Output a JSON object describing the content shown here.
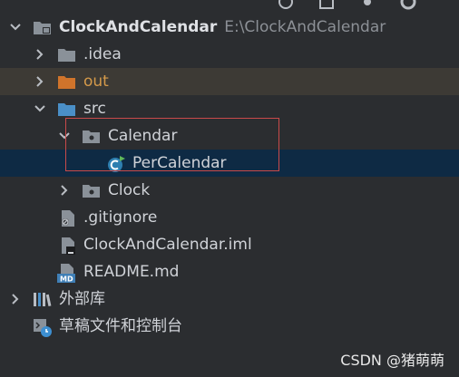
{
  "tree": {
    "root": {
      "label": "ClockAndCalendar",
      "path": "E:\\ClockAndCalendar"
    },
    "idea": {
      "label": ".idea"
    },
    "out": {
      "label": "out"
    },
    "src": {
      "label": "src"
    },
    "calendar_pkg": {
      "label": "Calendar"
    },
    "percalendar": {
      "label": "PerCalendar"
    },
    "clock_pkg": {
      "label": "Clock"
    },
    "gitignore": {
      "label": ".gitignore"
    },
    "iml": {
      "label": "ClockAndCalendar.iml"
    },
    "readme": {
      "label": "README.md",
      "icon_text": "MD"
    },
    "external_libs": {
      "label": "外部库"
    },
    "scratches": {
      "label": "草稿文件和控制台"
    }
  },
  "watermark": "CSDN @猪萌萌",
  "colors": {
    "background": "#2b2d30",
    "selected_row": "#0e2a44",
    "excluded_row": "#3d3a35",
    "excluded_text": "#d59a4a",
    "highlight_border": "#c94a4a",
    "folder": "#8a9199",
    "src_folder": "#4a8fc7"
  }
}
